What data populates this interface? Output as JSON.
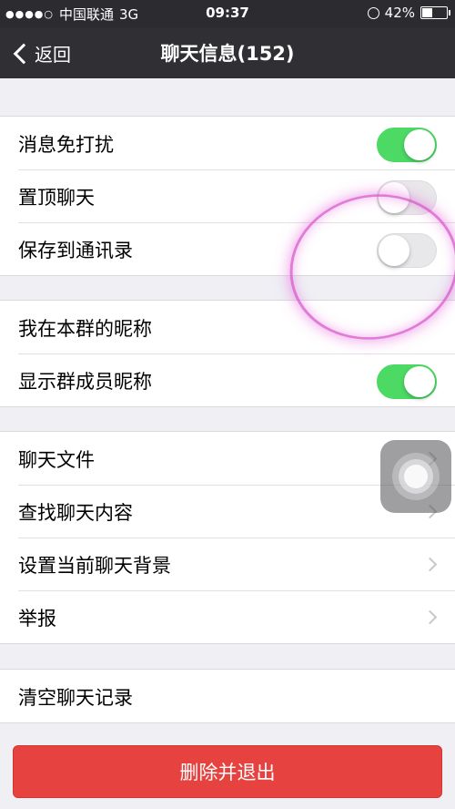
{
  "status_bar": {
    "carrier": "中国联通",
    "network": "3G",
    "time": "09:37",
    "battery": "42%"
  },
  "nav": {
    "back_label": "返回",
    "title": "聊天信息(152)"
  },
  "settings": {
    "mute": {
      "label": "消息免打扰",
      "on": true
    },
    "pin": {
      "label": "置顶聊天",
      "on": false
    },
    "save_contacts": {
      "label": "保存到通讯录",
      "on": false
    },
    "nickname": {
      "label": "我在本群的昵称"
    },
    "show_nicknames": {
      "label": "显示群成员昵称",
      "on": true
    },
    "chat_files": {
      "label": "聊天文件"
    },
    "search_chat": {
      "label": "查找聊天内容"
    },
    "set_background": {
      "label": "设置当前聊天背景"
    },
    "report": {
      "label": "举报"
    },
    "clear_history": {
      "label": "清空聊天记录"
    }
  },
  "actions": {
    "delete_exit": "删除并退出"
  },
  "colors": {
    "toggle_on": "#4cd964",
    "danger": "#e64340",
    "navbar": "#2f2f34",
    "background": "#efeff4"
  }
}
